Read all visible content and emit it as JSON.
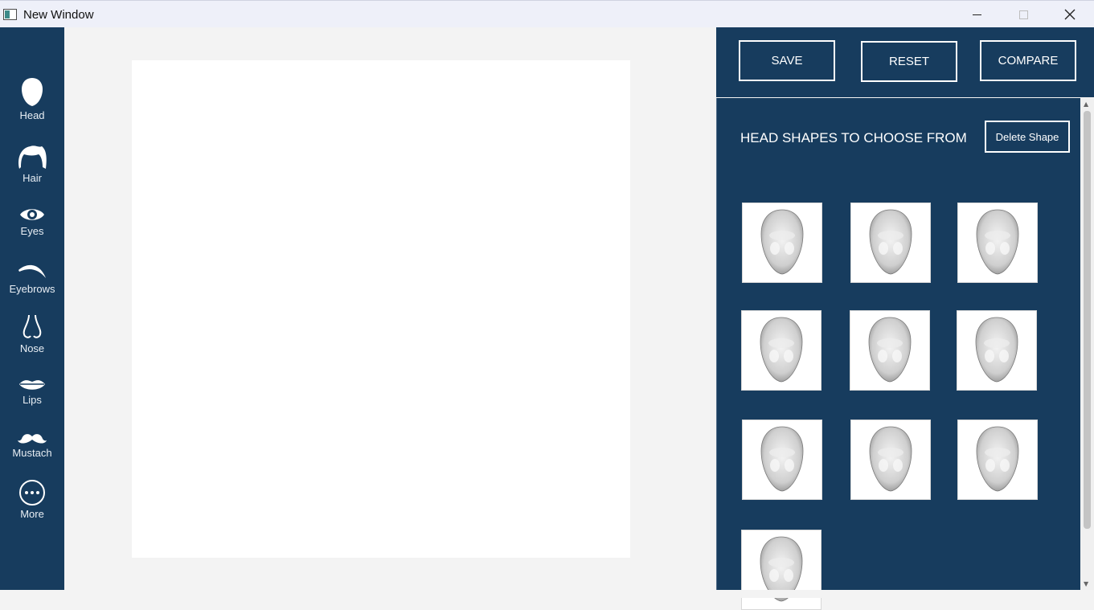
{
  "window": {
    "title": "New Window"
  },
  "sidebar": {
    "items": [
      {
        "label": "Head",
        "icon": "head-icon"
      },
      {
        "label": "Hair",
        "icon": "hair-icon"
      },
      {
        "label": "Eyes",
        "icon": "eye-icon"
      },
      {
        "label": "Eyebrows",
        "icon": "eyebrow-icon"
      },
      {
        "label": "Nose",
        "icon": "nose-icon"
      },
      {
        "label": "Lips",
        "icon": "lips-icon"
      },
      {
        "label": "Mustach",
        "icon": "mustache-icon"
      },
      {
        "label": "More",
        "icon": "more-icon"
      }
    ]
  },
  "toolbar": {
    "save_label": "SAVE",
    "reset_label": "RESET",
    "compare_label": "COMPARE"
  },
  "shapes": {
    "heading": "HEAD SHAPES TO CHOOSE FROM",
    "delete_label": "Delete Shape",
    "count": 10
  },
  "colors": {
    "panel": "#173c5e",
    "canvas": "#ffffff",
    "background": "#f3f3f3"
  }
}
